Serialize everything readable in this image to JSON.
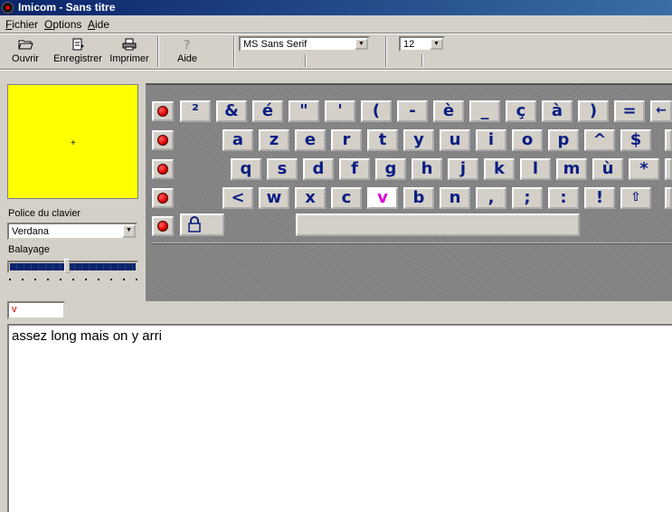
{
  "window": {
    "title": "Imicom - Sans titre"
  },
  "menu": [
    {
      "label": "Fichier",
      "accel": "F",
      "rest": "ichier"
    },
    {
      "label": "Options",
      "accel": "O",
      "rest": "ptions"
    },
    {
      "label": "Aide",
      "accel": "A",
      "rest": "ide"
    }
  ],
  "toolbar": {
    "open": "Ouvrir",
    "save": "Enregistrer",
    "print": "Imprimer",
    "help": "Aide",
    "font_value": "MS Sans Serif",
    "size_value": "12"
  },
  "left_panel": {
    "preview_cursor": "+",
    "keyboard_font_label": "Police du clavier",
    "keyboard_font_value": "Verdana",
    "scan_label": "Balayage",
    "scan_level_fraction": 0.45,
    "input_value": "v"
  },
  "keyboard": {
    "rows": [
      [
        "²",
        "&",
        "é",
        "\"",
        "'",
        "(",
        "-",
        "è",
        "_",
        "ç",
        "à",
        ")",
        "=",
        "←"
      ],
      [
        "a",
        "z",
        "e",
        "r",
        "t",
        "y",
        "u",
        "i",
        "o",
        "p",
        "^",
        "$"
      ],
      [
        "q",
        "s",
        "d",
        "f",
        "g",
        "h",
        "j",
        "k",
        "l",
        "m",
        "ù",
        "*"
      ],
      [
        "<",
        "w",
        "x",
        "c",
        "v",
        "b",
        "n",
        ",",
        ";",
        ":",
        "!",
        "⇧"
      ]
    ],
    "highlighted_key": "v",
    "colors": {
      "key_text": "#0a1e82",
      "highlight_text": "#e000e0",
      "row_dot": "#e00000",
      "preview_bg": "#ffff00"
    }
  },
  "document": {
    "text": "assez long mais on y arri"
  }
}
